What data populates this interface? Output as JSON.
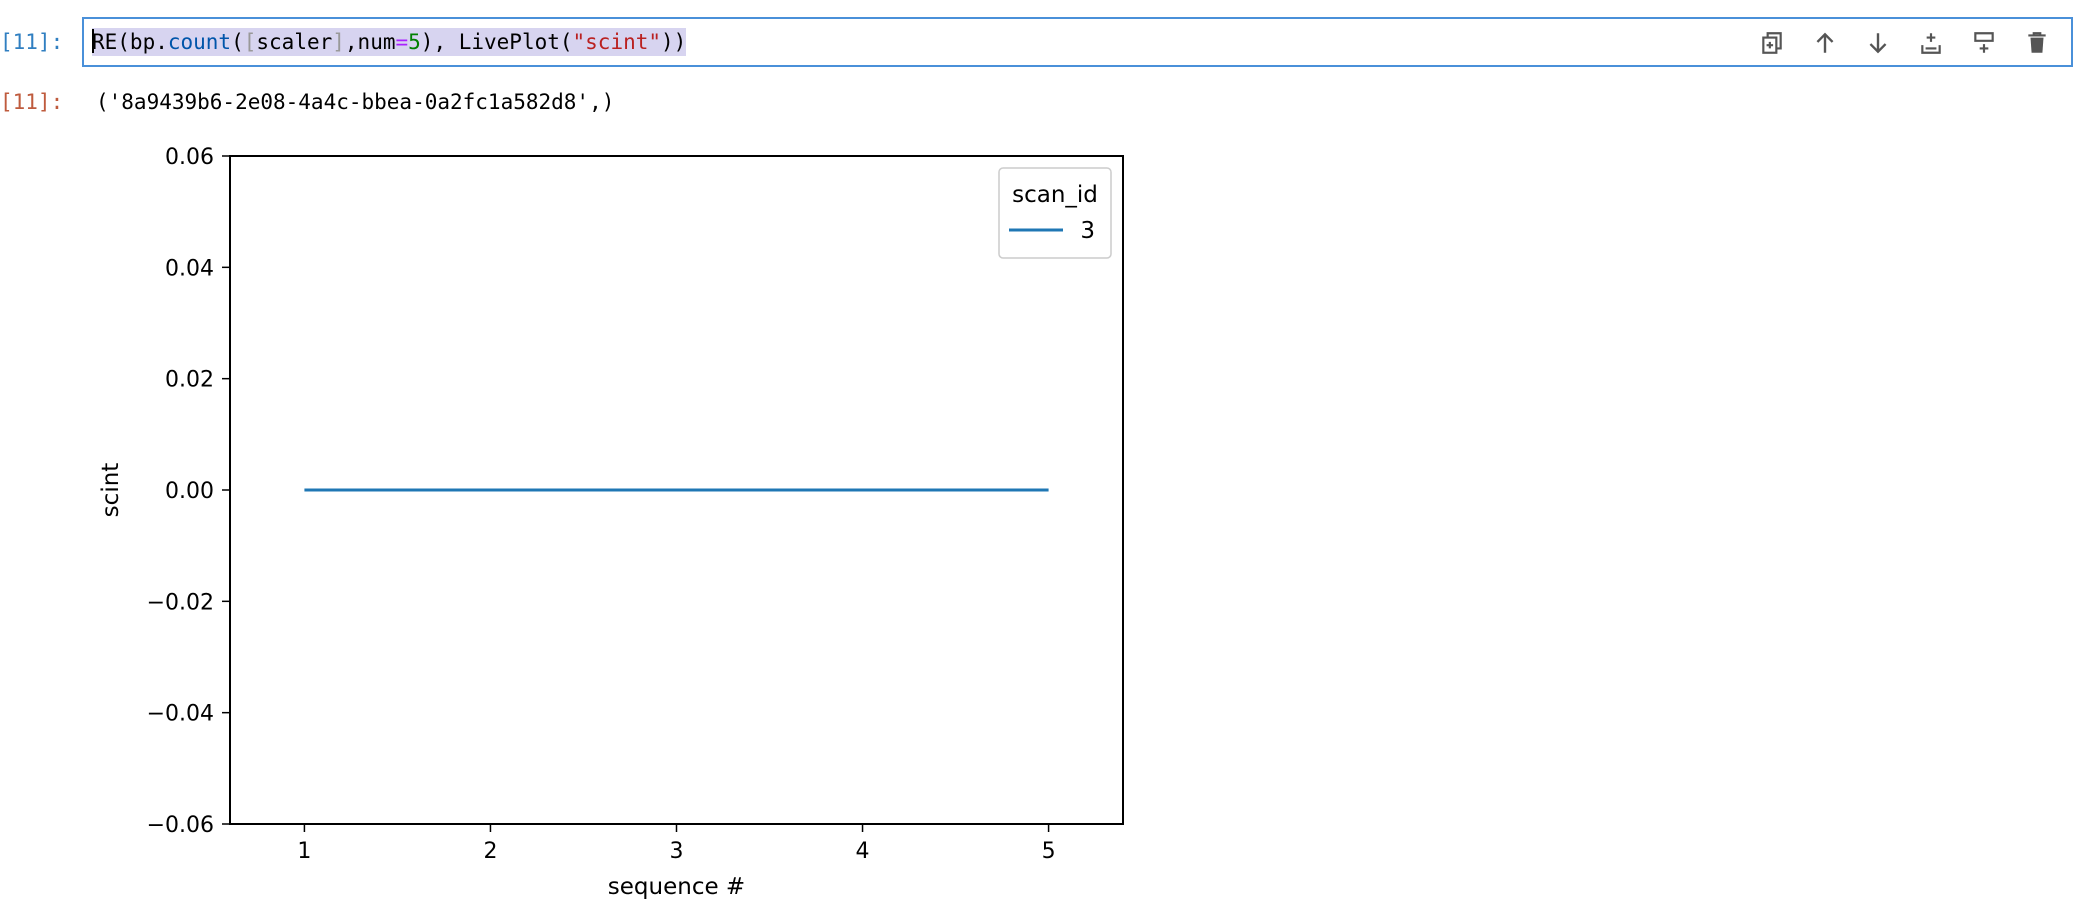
{
  "cell": {
    "input_prompt": "[11]:",
    "output_prompt": "[11]:",
    "code_tokens": {
      "t1": "RE(bp.",
      "t2": "count",
      "t3": "(",
      "t4": "[",
      "t5": "scaler",
      "t6": "]",
      "t7": ",num",
      "t8": "=",
      "t9": "5",
      "t10": "), LivePlot(",
      "t11": "\"scint\"",
      "t12": "))"
    },
    "output_text": "('8a9439b6-2e08-4a4c-bbea-0a2fc1a582d8',)"
  },
  "toolbar": {
    "icons": [
      "duplicate-icon",
      "move-up-icon",
      "move-down-icon",
      "insert-above-icon",
      "insert-below-icon",
      "delete-icon"
    ]
  },
  "colors": {
    "input_prompt": "#307fc1",
    "output_prompt": "#bf5b3d",
    "editor_border": "#4a90d9",
    "selection": "#d7d4f0",
    "series": "#1f77b4"
  },
  "chart_data": {
    "type": "line",
    "xlabel": "sequence #",
    "ylabel": "scint",
    "xlim": [
      0.6,
      5.4
    ],
    "ylim": [
      -0.06,
      0.06
    ],
    "x_ticks": [
      1,
      2,
      3,
      4,
      5
    ],
    "x_tick_labels": [
      "1",
      "2",
      "3",
      "4",
      "5"
    ],
    "y_ticks": [
      0.06,
      0.04,
      0.02,
      0.0,
      -0.02,
      -0.04,
      -0.06
    ],
    "y_tick_labels": [
      "0.06",
      "0.04",
      "0.02",
      "0.00",
      "−0.02",
      "−0.04",
      "−0.06"
    ],
    "legend_title": "scan_id",
    "legend_position": "upper-right",
    "grid": false,
    "series": [
      {
        "name": "3",
        "color": "#1f77b4",
        "x": [
          1,
          2,
          3,
          4,
          5
        ],
        "y": [
          0,
          0,
          0,
          0,
          0
        ]
      }
    ]
  }
}
